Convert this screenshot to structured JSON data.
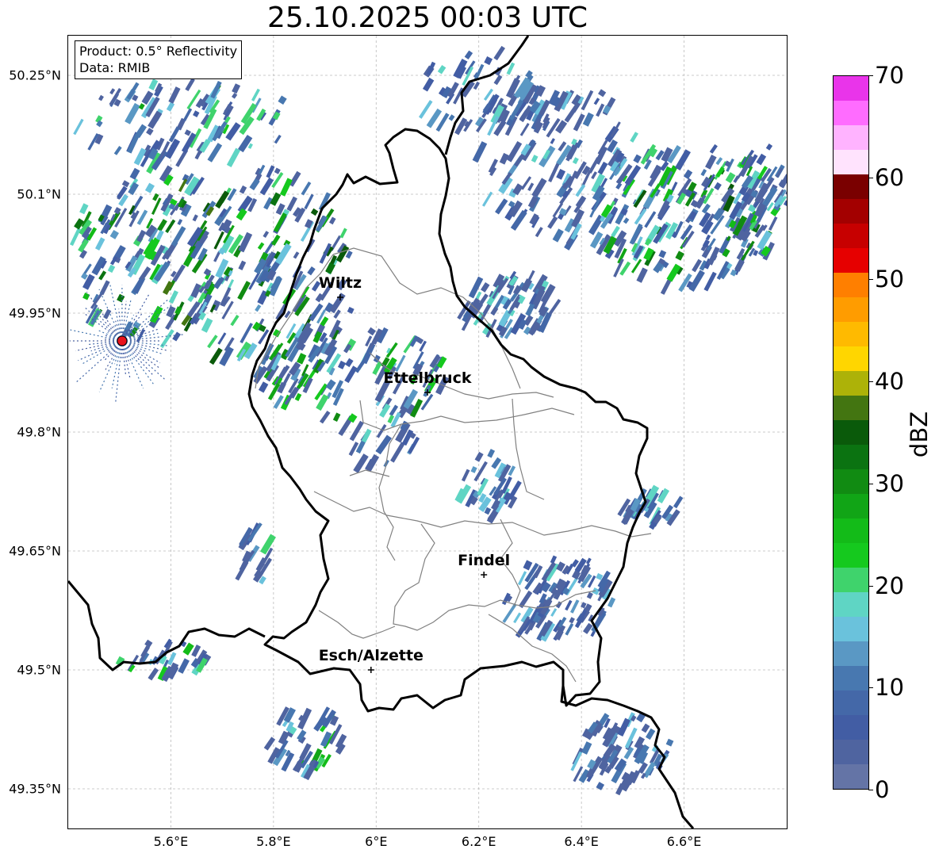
{
  "title": "25.10.2025 00:03 UTC",
  "info_box": {
    "product": "Product: 0.5° Reflectivity",
    "data_source": "Data: RMIB"
  },
  "axes": {
    "lon_ticks": [
      "5.6°E",
      "5.8°E",
      "6°E",
      "6.2°E",
      "6.4°E",
      "6.6°E"
    ],
    "lat_ticks": [
      "50.25°N",
      "50.1°N",
      "49.95°N",
      "49.8°N",
      "49.65°N",
      "49.5°N",
      "49.35°N"
    ],
    "lon_range": [
      5.4,
      6.8
    ],
    "lat_range": [
      49.3,
      50.3
    ],
    "grid": true
  },
  "cities": [
    {
      "name": "Wiltz",
      "lon": 5.93,
      "lat": 49.97
    },
    {
      "name": "Ettelbruck",
      "lon": 6.1,
      "lat": 49.85
    },
    {
      "name": "Findel",
      "lon": 6.21,
      "lat": 49.62
    },
    {
      "name": "Esch/Alzette",
      "lon": 5.99,
      "lat": 49.5
    }
  ],
  "radar_site": {
    "lon": 5.505,
    "lat": 49.915,
    "color": "#e8141e"
  },
  "colorbar": {
    "label": "dBZ",
    "ticks": [
      "0",
      "10",
      "20",
      "30",
      "40",
      "50",
      "60",
      "70"
    ],
    "colors": [
      "#6474a6",
      "#4f64a0",
      "#425da4",
      "#4468a8",
      "#4878b0",
      "#5a98c4",
      "#6ac2dc",
      "#5fd5c4",
      "#3fd36c",
      "#15c91e",
      "#13bb18",
      "#11a516",
      "#118b12",
      "#0b7311",
      "#0a5a0a",
      "#437511",
      "#adb208",
      "#ffd600",
      "#ffba00",
      "#ff9c00",
      "#ff7f00",
      "#e60000",
      "#c70000",
      "#a30000",
      "#7a0000",
      "#ffe3fd",
      "#ffb3ff",
      "#ff6cff",
      "#e934ea"
    ]
  }
}
